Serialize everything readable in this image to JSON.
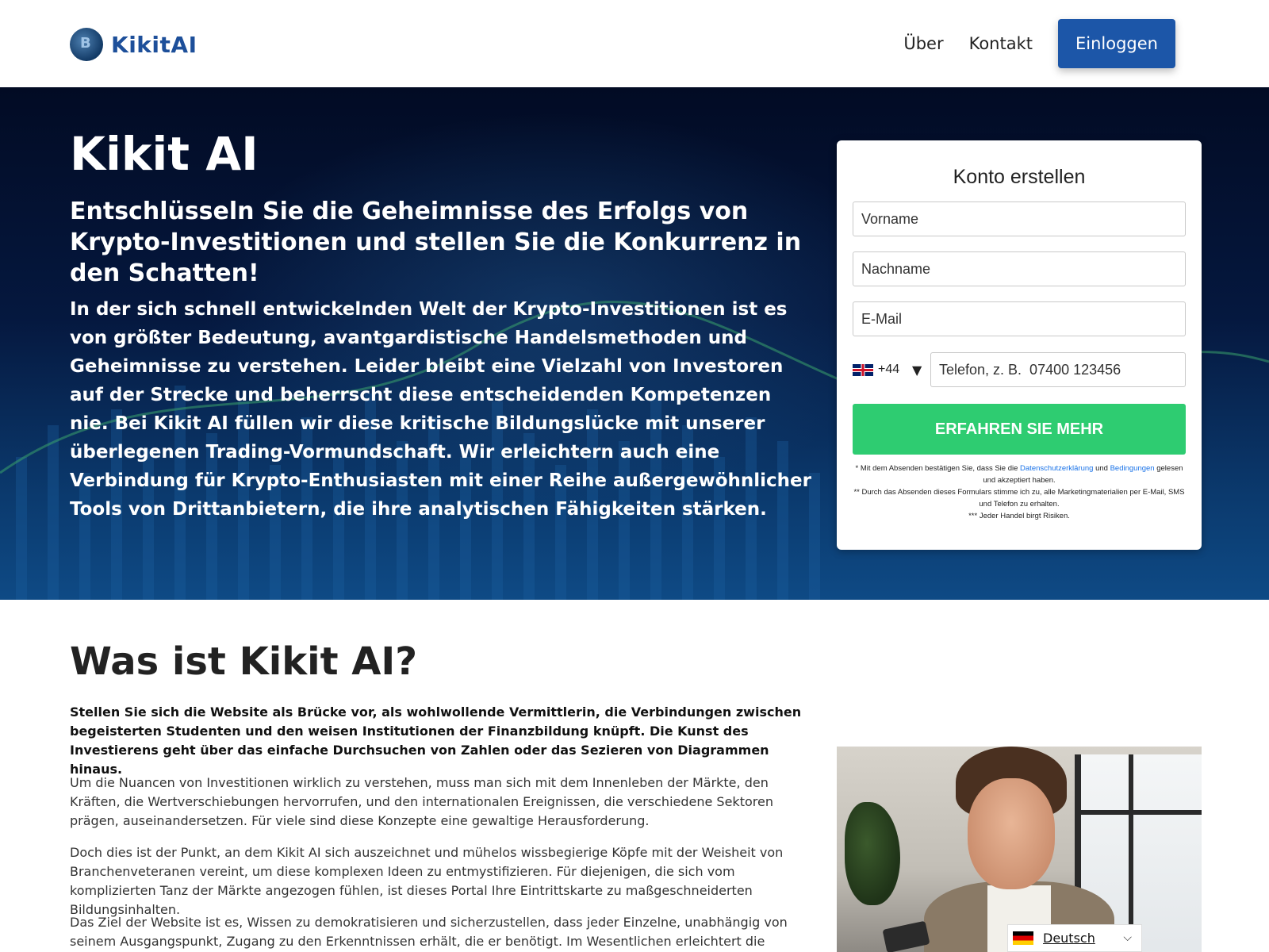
{
  "header": {
    "brand": "KikitAI",
    "nav": {
      "about": "Über",
      "contact": "Kontakt",
      "login": "Einloggen"
    }
  },
  "hero": {
    "title": "Kikit AI",
    "subtitle": "Entschlüsseln Sie die Geheimnisse des Erfolgs von Krypto-Investitionen und stellen Sie die Konkurrenz in den Schatten!",
    "body": "In der sich schnell entwickelnden Welt der Krypto-Investitionen ist es von größter Bedeutung, avantgardistische Handelsmethoden und Geheimnisse zu verstehen. Leider bleibt eine Vielzahl von Investoren auf der Strecke und beherrscht diese entscheidenden Kompetenzen nie. Bei Kikit AI füllen wir diese kritische Bildungslücke mit unserer überlegenen Trading-Vormundschaft. Wir erleichtern auch eine Verbindung für Krypto-Enthusiasten mit einer Reihe außergewöhnlicher Tools von Drittanbietern, die ihre analytischen Fähigkeiten stärken."
  },
  "form": {
    "title": "Konto erstellen",
    "first_name_placeholder": "Vorname",
    "last_name_placeholder": "Nachname",
    "email_placeholder": "E-Mail",
    "phone_code": "+44",
    "phone_caret": "▼",
    "phone_placeholder": "Telefon, z. B.  07400 123456",
    "submit": "ERFAHREN SIE MEHR",
    "disclaimer": {
      "line1_pre": "* Mit dem Absenden bestätigen Sie, dass Sie die ",
      "privacy": "Datenschutzerklärung",
      "and": " und ",
      "terms": "Bedingungen",
      "line1_post": " gelesen und akzeptiert haben.",
      "line2": "** Durch das Absenden dieses Formulars stimme ich zu, alle Marketingmaterialien per E-Mail, SMS und Telefon zu erhalten.",
      "line3": "*** Jeder Handel birgt Risiken."
    }
  },
  "about": {
    "title": "Was ist Kikit AI?",
    "lead": "Stellen Sie sich die Website als Brücke vor, als wohlwollende Vermittlerin, die Verbindungen zwischen begeisterten Studenten und den weisen Institutionen der Finanzbildung knüpft. Die Kunst des Investierens geht über das einfache Durchsuchen von Zahlen oder das Sezieren von Diagrammen hinaus.",
    "p1": "Um die Nuancen von Investitionen wirklich zu verstehen, muss man sich mit dem Innenleben der Märkte, den Kräften, die Wertverschiebungen hervorrufen, und den internationalen Ereignissen, die verschiedene Sektoren prägen, auseinandersetzen. Für viele sind diese Konzepte eine gewaltige Herausforderung.",
    "p2": "Doch dies ist der Punkt, an dem Kikit AI sich auszeichnet und mühelos wissbegierige Köpfe mit der Weisheit von Branchenveteranen vereint, um diese komplexen Ideen zu entmystifizieren. Für diejenigen, die sich vom komplizierten Tanz der Märkte angezogen fühlen, ist dieses Portal Ihre Eintrittskarte zu maßgeschneiderten Bildungsinhalten.",
    "p3": "Das Ziel der Website ist es, Wissen zu demokratisieren und sicherzustellen, dass jeder Einzelne, unabhängig von seinem Ausgangspunkt, Zugang zu den Erkenntnissen erhält, die er benötigt. Im Wesentlichen erleichtert die Website"
  },
  "language": {
    "label": "Deutsch",
    "chevron": "⌵"
  }
}
